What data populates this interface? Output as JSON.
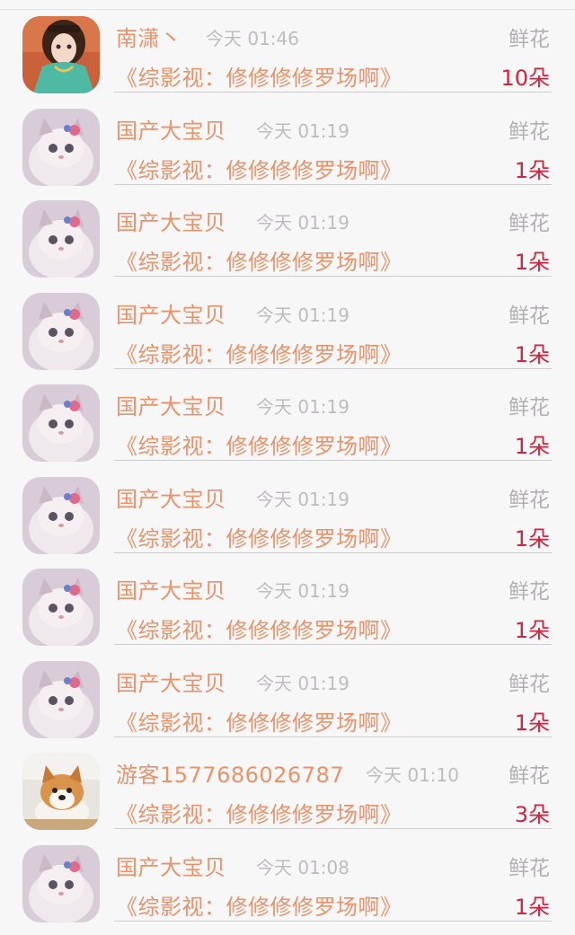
{
  "messages": [
    {
      "avatar": "doll-avatar",
      "name": "南潇丶",
      "time": "今天 01:46",
      "gift": "鲜花",
      "book": "《综影视：修修修修罗场啊》",
      "count": "10朵"
    },
    {
      "avatar": "kitten-avatar",
      "name": "国产大宝贝",
      "time": "今天 01:19",
      "gift": "鲜花",
      "book": "《综影视：修修修修罗场啊》",
      "count": "1朵"
    },
    {
      "avatar": "kitten-avatar",
      "name": "国产大宝贝",
      "time": "今天 01:19",
      "gift": "鲜花",
      "book": "《综影视：修修修修罗场啊》",
      "count": "1朵"
    },
    {
      "avatar": "kitten-avatar",
      "name": "国产大宝贝",
      "time": "今天 01:19",
      "gift": "鲜花",
      "book": "《综影视：修修修修罗场啊》",
      "count": "1朵"
    },
    {
      "avatar": "kitten-avatar",
      "name": "国产大宝贝",
      "time": "今天 01:19",
      "gift": "鲜花",
      "book": "《综影视：修修修修罗场啊》",
      "count": "1朵"
    },
    {
      "avatar": "kitten-avatar",
      "name": "国产大宝贝",
      "time": "今天 01:19",
      "gift": "鲜花",
      "book": "《综影视：修修修修罗场啊》",
      "count": "1朵"
    },
    {
      "avatar": "kitten-avatar",
      "name": "国产大宝贝",
      "time": "今天 01:19",
      "gift": "鲜花",
      "book": "《综影视：修修修修罗场啊》",
      "count": "1朵"
    },
    {
      "avatar": "kitten-avatar",
      "name": "国产大宝贝",
      "time": "今天 01:19",
      "gift": "鲜花",
      "book": "《综影视：修修修修罗场啊》",
      "count": "1朵"
    },
    {
      "avatar": "shiba-avatar",
      "name": "游客1577686026787",
      "time": "今天 01:10",
      "gift": "鲜花",
      "book": "《综影视：修修修修罗场啊》",
      "count": "3朵"
    },
    {
      "avatar": "kitten-avatar",
      "name": "国产大宝贝",
      "time": "今天 01:08",
      "gift": "鲜花",
      "book": "《综影视：修修修修罗场啊》",
      "count": "1朵"
    }
  ]
}
